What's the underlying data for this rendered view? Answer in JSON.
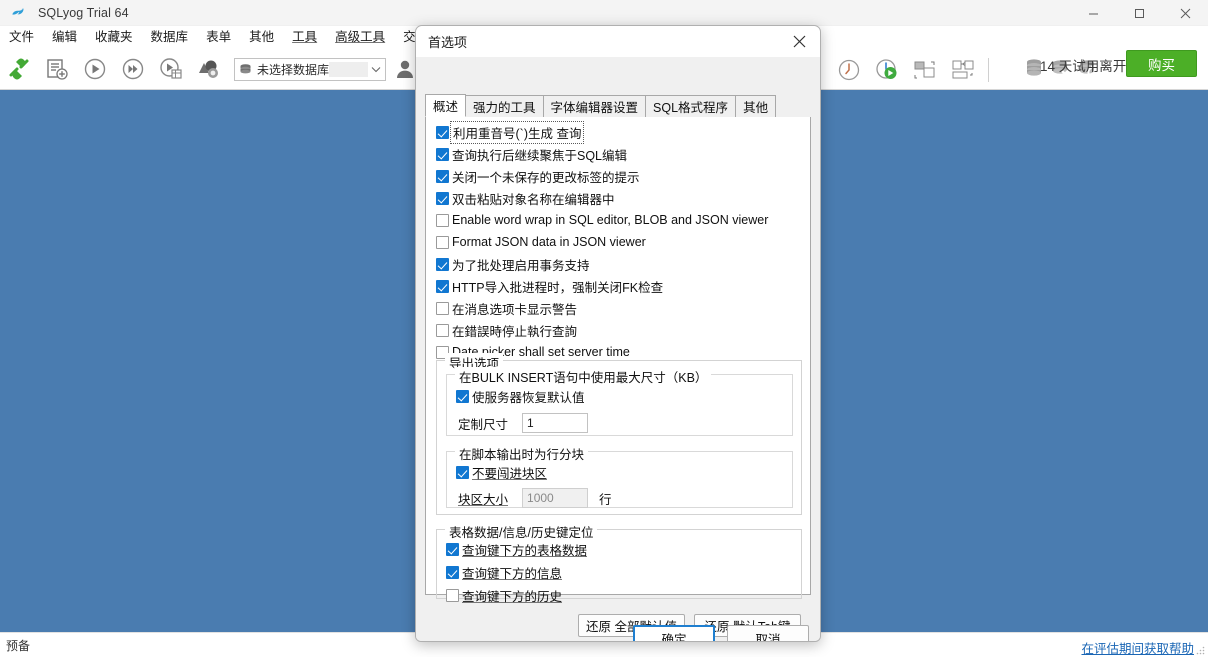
{
  "window": {
    "title": "SQLyog Trial 64",
    "app_icon": "dolphin-icon",
    "controls": {
      "minimize": "—",
      "maximize": "▢",
      "close": "✕"
    }
  },
  "menubar": {
    "items": [
      {
        "label": "文件",
        "name": "menu-file"
      },
      {
        "label": "编辑",
        "name": "menu-edit"
      },
      {
        "label": "收藏夹",
        "name": "menu-favorites"
      },
      {
        "label": "数据库",
        "name": "menu-database"
      },
      {
        "label": "表单",
        "name": "menu-table"
      },
      {
        "label": "其他",
        "name": "menu-other"
      },
      {
        "label": "工具",
        "name": "menu-tools"
      },
      {
        "label": "高级工具",
        "name": "menu-powertools"
      },
      {
        "label": "交易",
        "name": "menu-transaction"
      }
    ]
  },
  "toolbar": {
    "buttons": [
      {
        "name": "new-connection-icon",
        "title": "连接"
      },
      {
        "name": "new-query-tab-icon",
        "title": "新建查询"
      },
      {
        "name": "execute-query-icon",
        "title": "执行"
      },
      {
        "name": "execute-all-queries-icon",
        "title": "执行全部"
      },
      {
        "name": "execute-query-and-edit-icon",
        "title": "执行并编辑"
      },
      {
        "name": "stop-query-icon",
        "title": "停止"
      }
    ],
    "database_combo": {
      "name": "database-selector",
      "value": "未选择数据库",
      "icon": "database-icon",
      "arrow": "chevron-down-icon"
    },
    "user_icon": "user-icon",
    "right_buttons": [
      {
        "name": "query-history-icon"
      },
      {
        "name": "scheduled-query-icon"
      },
      {
        "name": "tile-horizontal-icon"
      },
      {
        "name": "tile-vertical-icon"
      }
    ],
    "trial": {
      "text": "14 天试用离开",
      "icons": [
        "database-stack-icon",
        "database-check-icon",
        "database-sync-icon"
      ],
      "buy_label": "购买",
      "buy_color": "#4caf27"
    }
  },
  "workspace": {
    "background": "#4a7cb0"
  },
  "statusbar": {
    "text": "预备",
    "help_link": "在评估期间获取帮助",
    "link_color": "#1a66b5",
    "grip": "resize-grip-icon"
  },
  "dialog": {
    "title": "首选项",
    "close_icon": "close-icon",
    "tabs": [
      {
        "label": "概述",
        "active": true
      },
      {
        "label": "强力的工具",
        "active": false
      },
      {
        "label": "字体编辑器设置",
        "active": false
      },
      {
        "label": "SQL格式程序",
        "active": false
      },
      {
        "label": "其他",
        "active": false
      }
    ],
    "checkboxes": [
      {
        "label": "利用重音号(`)生成 查询",
        "checked": true,
        "focused": true
      },
      {
        "label": "查询执行后继续聚焦于SQL编辑",
        "checked": true,
        "focused": false
      },
      {
        "label": "关闭一个未保存的更改标签的提示",
        "checked": true,
        "focused": false
      },
      {
        "label": "双击粘贴对象名称在编辑器中",
        "checked": true,
        "focused": false
      },
      {
        "label": "Enable word wrap in SQL editor, BLOB and JSON viewer",
        "checked": false,
        "focused": false
      },
      {
        "label": "Format JSON data in JSON viewer",
        "checked": false,
        "focused": false
      },
      {
        "label": "为了批处理启用事务支持",
        "checked": true,
        "focused": false
      },
      {
        "label": "HTTP导入批进程时，强制关闭FK检查",
        "checked": true,
        "focused": false
      },
      {
        "label": "在消息选项卡显示警告",
        "checked": false,
        "focused": false
      },
      {
        "label": "在錯誤時停止執行查詢",
        "checked": false,
        "focused": false
      },
      {
        "label": "Date picker shall set server time",
        "checked": false,
        "focused": false
      }
    ],
    "export_group": {
      "title": "导出选项",
      "bulk_insert": {
        "title": "在BULK INSERT语句中使用最大尺寸（KB）",
        "checkbox": {
          "label": "使服务器恢复默认值",
          "checked": true
        },
        "field_label": "定制尺寸",
        "field_value": "1",
        "field_disabled": false
      },
      "chunk": {
        "title": "在脚本输出时为行分块",
        "checkbox": {
          "label": "不要闯进块区",
          "checked": true
        },
        "field_label": "块区大小",
        "field_value": "1000",
        "field_disabled": true,
        "unit": "行"
      }
    },
    "keys_group": {
      "title": "表格数据/信息/历史键定位",
      "checkboxes": [
        {
          "label": "查询键下方的表格数据",
          "checked": true
        },
        {
          "label": "查询键下方的信息",
          "checked": true
        },
        {
          "label": "查询键下方的历史",
          "checked": false
        }
      ]
    },
    "restore_buttons": [
      {
        "label": "还原 全部默认值",
        "name": "restore-all-defaults-button"
      },
      {
        "label": "还原 默认Tab键",
        "name": "restore-default-tab-button"
      }
    ],
    "footer_buttons": [
      {
        "label": "确定",
        "name": "ok-button",
        "default": true
      },
      {
        "label": "取消",
        "name": "cancel-button",
        "default": false
      }
    ]
  }
}
